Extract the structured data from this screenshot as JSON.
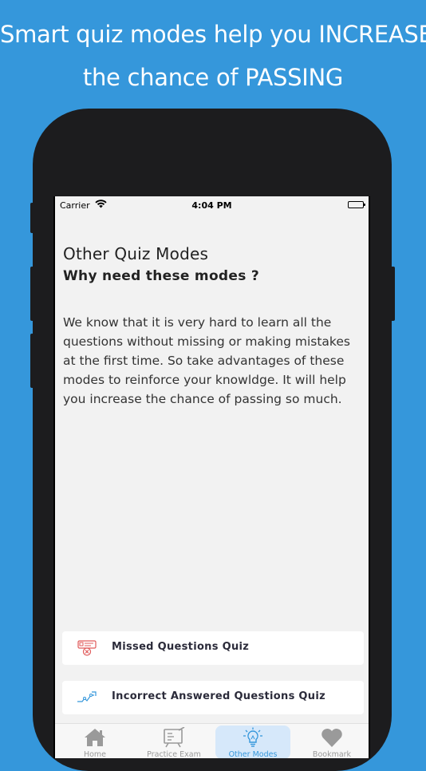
{
  "headline": {
    "line1": "Smart quiz modes help you INCREASE",
    "line2": "the chance of PASSING"
  },
  "status_bar": {
    "carrier": "Carrier",
    "time": "4:04 PM"
  },
  "content": {
    "title": "Other Quiz Modes",
    "subtitle": "Why need these modes ?",
    "description": "We know that it is very hard to learn all the questions without missing or making mistakes at the first time. So take advantages of these modes to reinforce your knowldge. It will help you increase the chance of passing so much."
  },
  "quiz_modes": [
    {
      "label": "Missed Questions Quiz",
      "icon": "missed-questions-icon"
    },
    {
      "label": "Incorrect Answered Questions Quiz",
      "icon": "trend-chart-icon"
    }
  ],
  "tabs": [
    {
      "label": "Home",
      "icon": "home-icon",
      "active": false
    },
    {
      "label": "Practice Exam",
      "icon": "exam-board-icon",
      "active": false
    },
    {
      "label": "Other Modes",
      "icon": "lightbulb-icon",
      "active": true
    },
    {
      "label": "Bookmark",
      "icon": "heart-icon",
      "active": false
    }
  ],
  "colors": {
    "background": "#3597db",
    "accent": "#3597db",
    "missed_icon": "#e05a5a"
  }
}
